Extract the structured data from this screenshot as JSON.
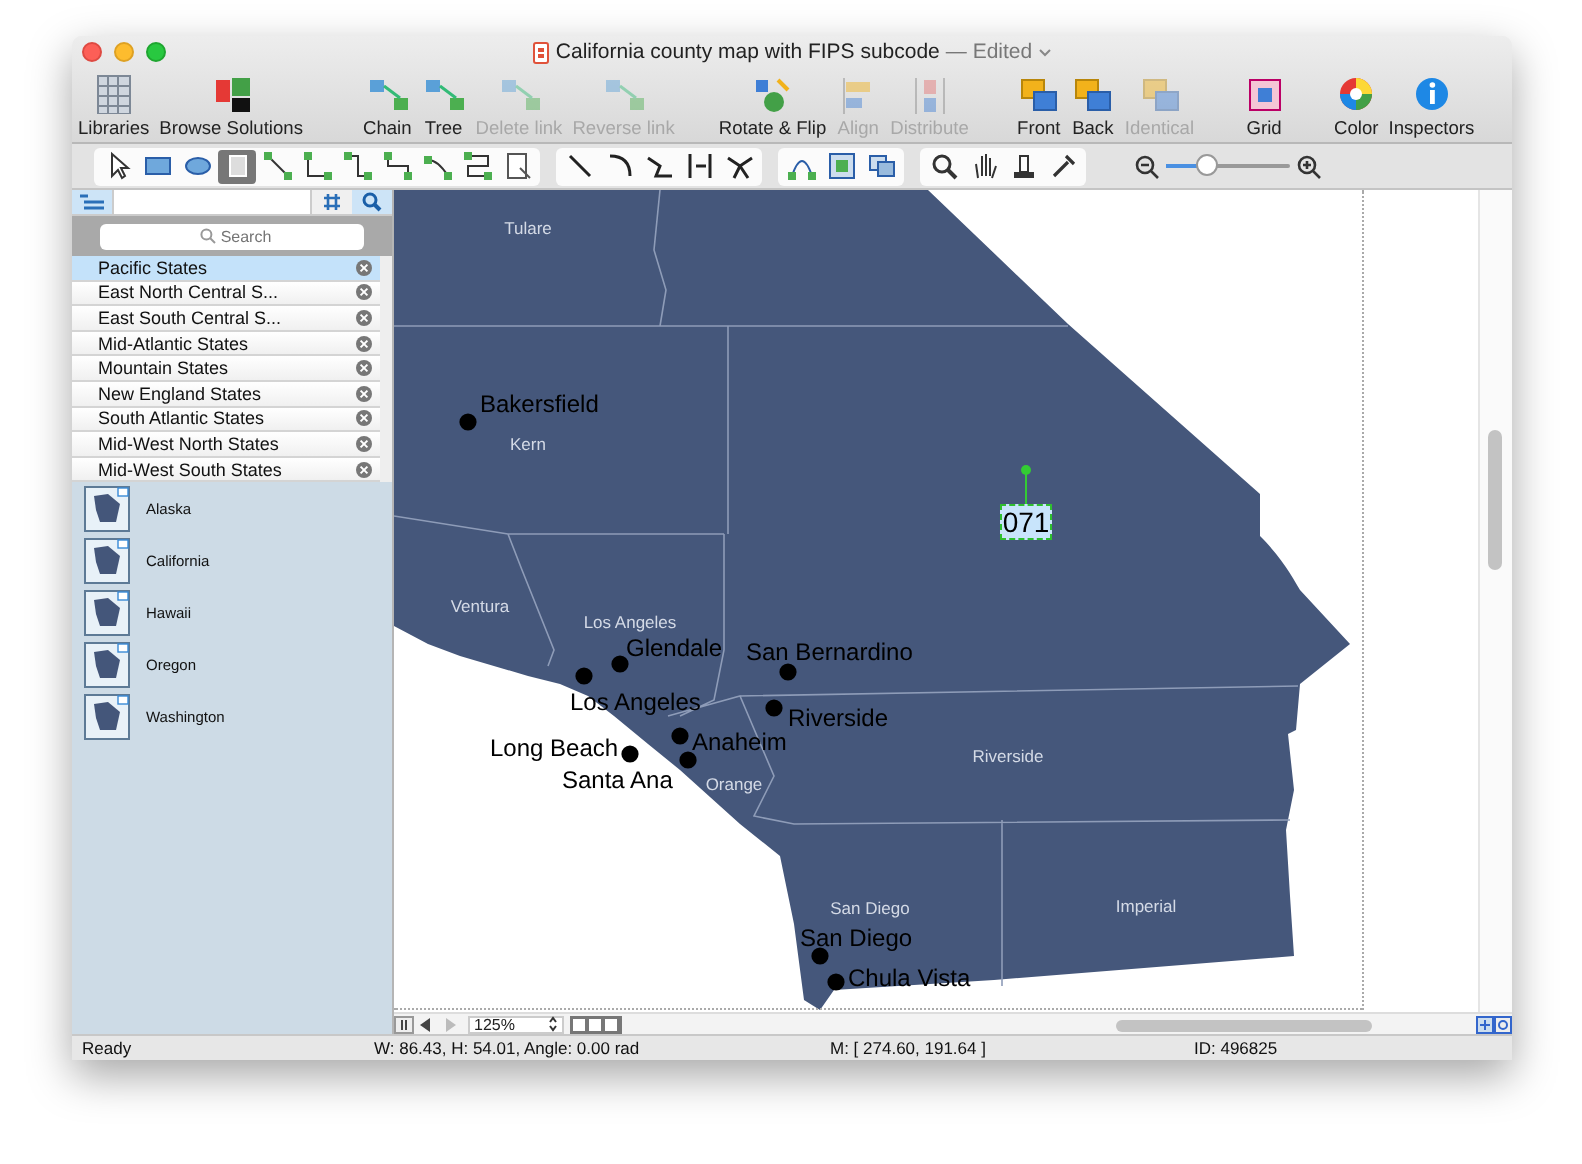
{
  "window": {
    "title": "California county map with FIPS subcode",
    "subtitle": "— Edited"
  },
  "toolbar": [
    {
      "label": "Libraries",
      "disabled": false
    },
    {
      "label": "Browse Solutions",
      "disabled": false
    },
    {
      "label": "Chain",
      "disabled": false
    },
    {
      "label": "Tree",
      "disabled": false
    },
    {
      "label": "Delete link",
      "disabled": true
    },
    {
      "label": "Reverse link",
      "disabled": true
    },
    {
      "label": "Rotate & Flip",
      "disabled": false
    },
    {
      "label": "Align",
      "disabled": true
    },
    {
      "label": "Distribute",
      "disabled": true
    },
    {
      "label": "Front",
      "disabled": false
    },
    {
      "label": "Back",
      "disabled": false
    },
    {
      "label": "Identical",
      "disabled": true
    },
    {
      "label": "Grid",
      "disabled": false
    },
    {
      "label": "Color",
      "disabled": false
    },
    {
      "label": "Inspectors",
      "disabled": false
    }
  ],
  "tool_groups": [
    [
      {
        "selected": false
      },
      {
        "selected": false
      },
      {
        "selected": false
      },
      {
        "selected": true
      },
      {
        "selected": false
      },
      {
        "selected": false
      },
      {
        "selected": false
      },
      {
        "selected": false
      },
      {
        "selected": false
      },
      {
        "selected": false
      },
      {
        "selected": false
      }
    ],
    [
      {
        "selected": false
      },
      {
        "selected": false
      },
      {
        "selected": false
      },
      {
        "selected": false
      },
      {
        "selected": false
      }
    ],
    [
      {
        "selected": false
      },
      {
        "selected": false
      },
      {
        "selected": false
      }
    ],
    [
      {
        "selected": false
      },
      {
        "selected": false
      },
      {
        "selected": false
      },
      {
        "selected": false
      }
    ]
  ],
  "zoom_slider": {
    "level": 0.32
  },
  "library_panel": {
    "search": {
      "placeholder": "Search"
    },
    "groups": [
      {
        "label": "Pacific States",
        "selected": true
      },
      {
        "label": "East North Central S...",
        "selected": false
      },
      {
        "label": "East South Central S...",
        "selected": false
      },
      {
        "label": "Mid-Atlantic States",
        "selected": false
      },
      {
        "label": "Mountain States",
        "selected": false
      },
      {
        "label": "New England States",
        "selected": false
      },
      {
        "label": "South Atlantic States",
        "selected": false
      },
      {
        "label": "Mid-West North States",
        "selected": false
      },
      {
        "label": "Mid-West South States",
        "selected": false
      }
    ],
    "shapes": [
      {
        "label": "Alaska"
      },
      {
        "label": "California"
      },
      {
        "label": "Hawaii"
      },
      {
        "label": "Oregon"
      },
      {
        "label": "Washington"
      }
    ]
  },
  "map": {
    "counties": [
      {
        "name": "Tulare"
      },
      {
        "name": "Kern"
      },
      {
        "name": "Ventura"
      },
      {
        "name": "Los Angeles"
      },
      {
        "name": "Riverside"
      },
      {
        "name": "Orange"
      },
      {
        "name": "San Diego"
      },
      {
        "name": "Imperial"
      }
    ],
    "cities": [
      {
        "name": "Bakersfield"
      },
      {
        "name": "Glendale"
      },
      {
        "name": "San Bernardino"
      },
      {
        "name": "Los Angeles"
      },
      {
        "name": "Riverside"
      },
      {
        "name": "Anaheim"
      },
      {
        "name": "Long Beach"
      },
      {
        "name": "Santa Ana"
      },
      {
        "name": "San Diego"
      },
      {
        "name": "Chula Vista"
      }
    ],
    "selected_label": "071"
  },
  "canvas_controls": {
    "zoom": "125%"
  },
  "status_bar": {
    "state": "Ready",
    "size": "W: 86.43,  H: 54.01,  Angle: 0.00 rad",
    "mouse": "M: [ 274.60, 191.64 ]",
    "id": "ID: 496825"
  }
}
